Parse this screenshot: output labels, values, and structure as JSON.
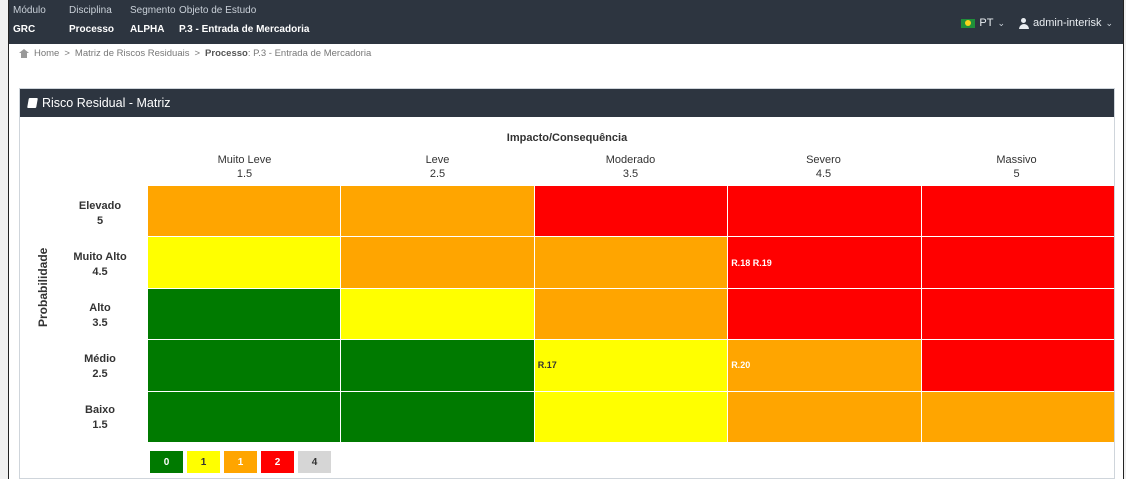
{
  "context": [
    {
      "label": "Módulo",
      "value": "GRC"
    },
    {
      "label": "Disciplina",
      "value": "Processo"
    },
    {
      "label": "Segmento",
      "value": "ALPHA"
    },
    {
      "label": "Objeto de Estudo",
      "value": "P.3 - Entrada de Mercadoria"
    }
  ],
  "nav": {
    "language": "PT",
    "user": "admin-interisk"
  },
  "breadcrumb": {
    "home": "Home",
    "sep": ">",
    "matrix": "Matriz de Riscos Residuais",
    "process_label": "Processo",
    "process_value": ": P.3 - Entrada de Mercadoria"
  },
  "panel": {
    "title": "Risco Residual - Matriz"
  },
  "matrix": {
    "impact_title": "Impacto/Consequência",
    "prob_title": "Probabilidade",
    "columns": [
      {
        "name": "Muito Leve",
        "value": "1.5"
      },
      {
        "name": "Leve",
        "value": "2.5"
      },
      {
        "name": "Moderado",
        "value": "3.5"
      },
      {
        "name": "Severo",
        "value": "4.5"
      },
      {
        "name": "Massivo",
        "value": "5"
      }
    ],
    "rows": [
      {
        "name": "Elevado",
        "value": "5"
      },
      {
        "name": "Muito Alto",
        "value": "4.5"
      },
      {
        "name": "Alto",
        "value": "3.5"
      },
      {
        "name": "Médio",
        "value": "2.5"
      },
      {
        "name": "Baixo",
        "value": "1.5"
      }
    ],
    "levels": [
      [
        2,
        2,
        3,
        3,
        3
      ],
      [
        1,
        2,
        2,
        3,
        3
      ],
      [
        0,
        1,
        2,
        3,
        3
      ],
      [
        0,
        0,
        1,
        2,
        3
      ],
      [
        0,
        0,
        1,
        2,
        2
      ]
    ],
    "risks": [
      [
        "",
        "",
        "",
        "",
        ""
      ],
      [
        "",
        "",
        "",
        "R.18 R.19",
        ""
      ],
      [
        "",
        "",
        "",
        "",
        ""
      ],
      [
        "",
        "",
        "R.17",
        "R.20",
        ""
      ],
      [
        "",
        "",
        "",
        "",
        ""
      ]
    ]
  },
  "level_colors": [
    "#007a00",
    "#ffff00",
    "#ffa500",
    "#ff0000",
    "#d6d6d6"
  ],
  "level_text_colors": [
    "#ffffff",
    "#333333",
    "#ffffff",
    "#ffffff",
    "#333333"
  ],
  "legend": [
    "0",
    "1",
    "1",
    "2",
    "4"
  ],
  "legend_levels": [
    0,
    1,
    2,
    3,
    4
  ]
}
